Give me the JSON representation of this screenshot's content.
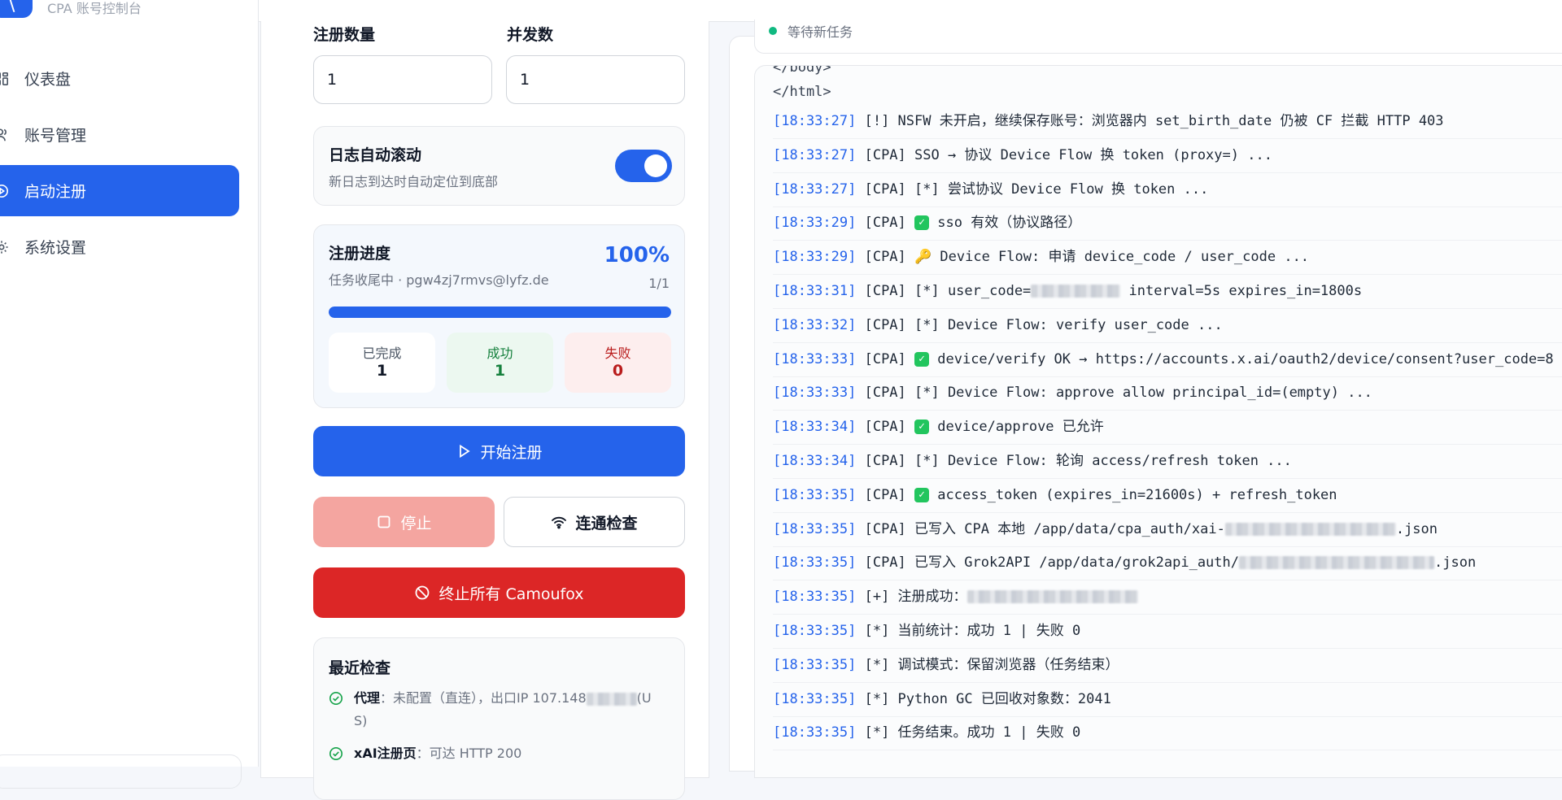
{
  "app": {
    "logo_letter": "\\",
    "subtitle": "CPA 账号控制台"
  },
  "sidebar": {
    "items": [
      {
        "label": "仪表盘",
        "active": false,
        "icon": "dashboard-icon"
      },
      {
        "label": "账号管理",
        "active": false,
        "icon": "users-icon"
      },
      {
        "label": "启动注册",
        "active": true,
        "icon": "play-circle-icon"
      },
      {
        "label": "系统设置",
        "active": false,
        "icon": "gear-icon"
      }
    ]
  },
  "form": {
    "count_label": "注册数量",
    "count_value": "1",
    "concurrency_label": "并发数",
    "concurrency_value": "1"
  },
  "autoscroll": {
    "title": "日志自动滚动",
    "subtitle": "新日志到达时自动定位到底部",
    "enabled": true
  },
  "progress": {
    "title": "注册进度",
    "subtitle": "任务收尾中 · pgw4zj7rmvs@lyfz.de",
    "percent_text": "100%",
    "percent": 100,
    "count_text": "1/1",
    "stats": {
      "done_label": "已完成",
      "done_value": "1",
      "success_label": "成功",
      "success_value": "1",
      "fail_label": "失败",
      "fail_value": "0"
    }
  },
  "buttons": {
    "start": "开始注册",
    "stop": "停止",
    "check": "连通检查",
    "kill": "终止所有 Camoufox"
  },
  "recent_check": {
    "title": "最近检查",
    "proxy_label": "代理",
    "proxy_detail_a": "：未配置（直连），出口IP 107.148",
    "proxy_detail_b": "(U",
    "proxy_detail_c": "S)",
    "xai_label": "xAI注册页",
    "xai_detail": "：可达 HTTP 200"
  },
  "status": {
    "text": "等待新任务",
    "color": "#10b981"
  },
  "log": {
    "pre_lines": [
      "</body>",
      "</html>"
    ],
    "lines": [
      {
        "ts": "[18:33:27]",
        "msg": " [!] NSFW 未开启，继续保存账号：浏览器内 set_birth_date 仍被 CF 拦截 HTTP 403"
      },
      {
        "ts": "[18:33:27]",
        "msg": " [CPA] SSO → 协议 Device Flow 换 token (proxy=) ..."
      },
      {
        "ts": "[18:33:27]",
        "msg": " [CPA] [*] 尝试协议 Device Flow 换 token ..."
      },
      {
        "ts": "[18:33:29]",
        "msg": " [CPA] ",
        "check": true,
        "msg2": " sso 有效（协议路径）"
      },
      {
        "ts": "[18:33:29]",
        "msg": " [CPA] 🔑 Device Flow: 申请 device_code / user_code ..."
      },
      {
        "ts": "[18:33:31]",
        "msg": " [CPA] [*] user_code=",
        "blur": 110,
        "msg2": " interval=5s expires_in=1800s"
      },
      {
        "ts": "[18:33:32]",
        "msg": " [CPA] [*] Device Flow: verify user_code ..."
      },
      {
        "ts": "[18:33:33]",
        "msg": " [CPA] ",
        "check": true,
        "msg2": " device/verify OK → https://accounts.x.ai/oauth2/device/consent?user_code=8"
      },
      {
        "ts": "[18:33:33]",
        "msg": " [CPA] [*] Device Flow: approve allow principal_id=(empty) ..."
      },
      {
        "ts": "[18:33:34]",
        "msg": " [CPA] ",
        "check": true,
        "msg2": " device/approve 已允许"
      },
      {
        "ts": "[18:33:34]",
        "msg": " [CPA] [*] Device Flow: 轮询 access/refresh token ..."
      },
      {
        "ts": "[18:33:35]",
        "msg": " [CPA] ",
        "check": true,
        "msg2": " access_token (expires_in=21600s) + refresh_token"
      },
      {
        "ts": "[18:33:35]",
        "msg": " [CPA] 已写入 CPA 本地 /app/data/cpa_auth/xai-",
        "blur": 210,
        "msg2": ".json"
      },
      {
        "ts": "[18:33:35]",
        "msg": " [CPA] 已写入 Grok2API /app/data/grok2api_auth/",
        "blur": 240,
        "msg2": ".json"
      },
      {
        "ts": "[18:33:35]",
        "msg": " [+] 注册成功：",
        "blur": 210,
        "msg2": ""
      },
      {
        "ts": "[18:33:35]",
        "msg": " [*] 当前统计：成功 1 | 失败 0"
      },
      {
        "ts": "[18:33:35]",
        "msg": " [*] 调试模式：保留浏览器（任务结束）"
      },
      {
        "ts": "[18:33:35]",
        "msg": " [*] Python GC 已回收对象数：2041"
      },
      {
        "ts": "[18:33:35]",
        "msg": " [*] 任务结束。成功 1 | 失败 0"
      }
    ]
  },
  "colors": {
    "accent": "#2563eb",
    "success": "#16a34a",
    "danger": "#dc2626",
    "stop": "#f4a5a0"
  }
}
